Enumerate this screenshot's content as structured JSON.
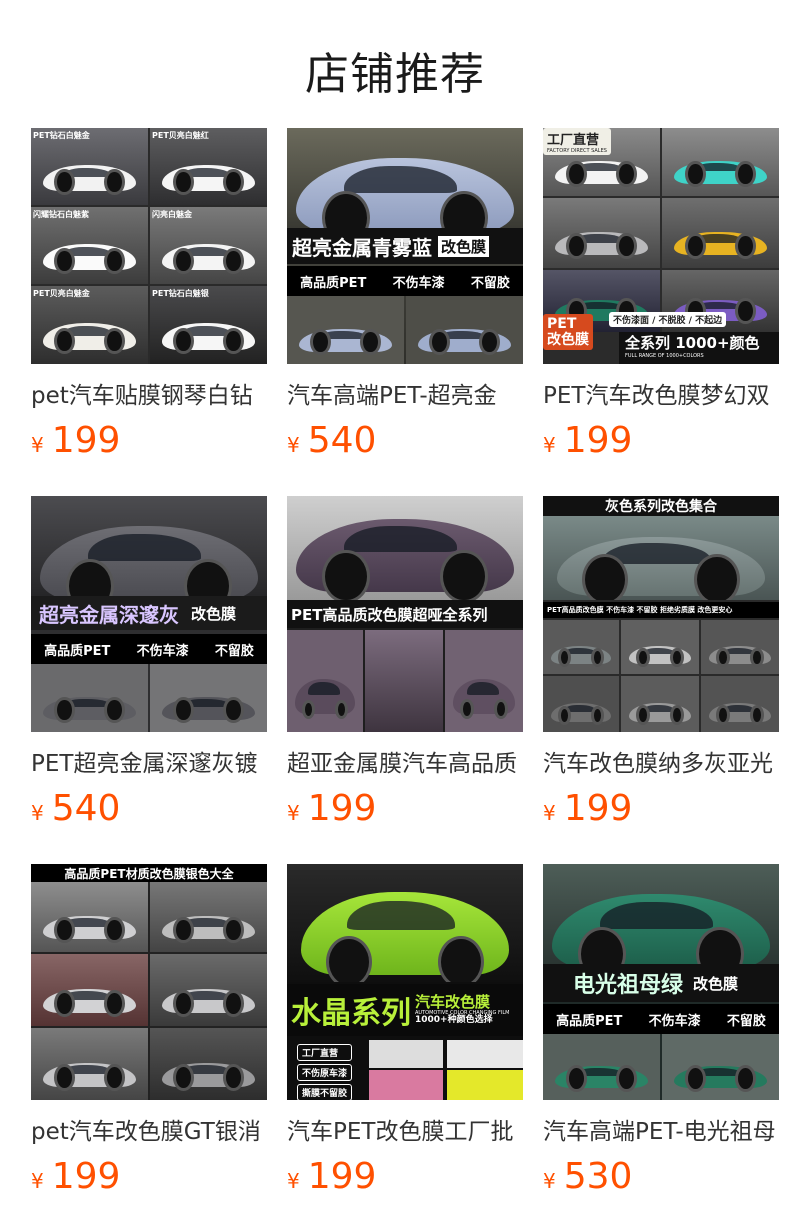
{
  "page": {
    "title": "店铺推荐"
  },
  "currency_symbol": "¥",
  "products": [
    {
      "name": "pet汽车贴膜钢琴白钻",
      "price": "199",
      "image_text": {
        "labels": [
          "PET钻石白魅金",
          "PET贝亮白魅红",
          "闪耀钻石白魅紫",
          "闪亮白魅金",
          "PET贝亮白魅金",
          "PET钻石白魅银"
        ]
      }
    },
    {
      "name": "汽车高端PET-超亮金",
      "price": "540",
      "image_text": {
        "headline": "超亮金属青雾蓝",
        "badge": "改色膜",
        "features": [
          "高品质PET",
          "不伤车漆",
          "不留胶"
        ]
      }
    },
    {
      "name": "PET汽车改色膜梦幻双",
      "price": "199",
      "image_text": {
        "corner": "工厂直营",
        "corner_sub": "FACTORY DIRECT SALES",
        "pet": "PET",
        "pet_sub": "改色膜",
        "tags": "不伤漆面 / 不脱胶 / 不起边",
        "series": "全系列 1000+颜色",
        "series_sub": "FULL RANGE OF 1000+COLORS"
      }
    },
    {
      "name": "PET超亮金属深邃灰镀",
      "price": "540",
      "image_text": {
        "headline": "超亮金属深邃灰",
        "badge": "改色膜",
        "features": [
          "高品质PET",
          "不伤车漆",
          "不留胶"
        ]
      }
    },
    {
      "name": "超亚金属膜汽车高品质",
      "price": "199",
      "image_text": {
        "headline": "PET高品质改色膜超哑全系列"
      }
    },
    {
      "name": "汽车改色膜纳多灰亚光",
      "price": "199",
      "image_text": {
        "headline": "灰色系列改色集合",
        "strip": "PET高品质改色膜   不伤车漆   不留胶   拒绝劣质膜   改色更安心"
      }
    },
    {
      "name": "pet汽车改色膜GT银消",
      "price": "199",
      "image_text": {
        "headline": "高品质PET材质改色膜银色大全"
      }
    },
    {
      "name": "汽车PET改色膜工厂批",
      "price": "199",
      "image_text": {
        "series": "水晶系列",
        "title": "汽车改色膜",
        "title_sub": "AUTOMOTIVE COLOR CHANGING FILM",
        "count": "1000+种颜色选择",
        "features": [
          "工厂直营",
          "不伤原车漆",
          "撕膜不留胶"
        ]
      }
    },
    {
      "name": "汽车高端PET-电光祖母",
      "price": "530",
      "image_text": {
        "headline": "电光祖母绿",
        "badge": "改色膜",
        "features": [
          "高品质PET",
          "不伤车漆",
          "不留胶"
        ]
      }
    }
  ],
  "colors": {
    "price": "#ff5000",
    "title": "#1a1a1a",
    "name": "#333333"
  }
}
